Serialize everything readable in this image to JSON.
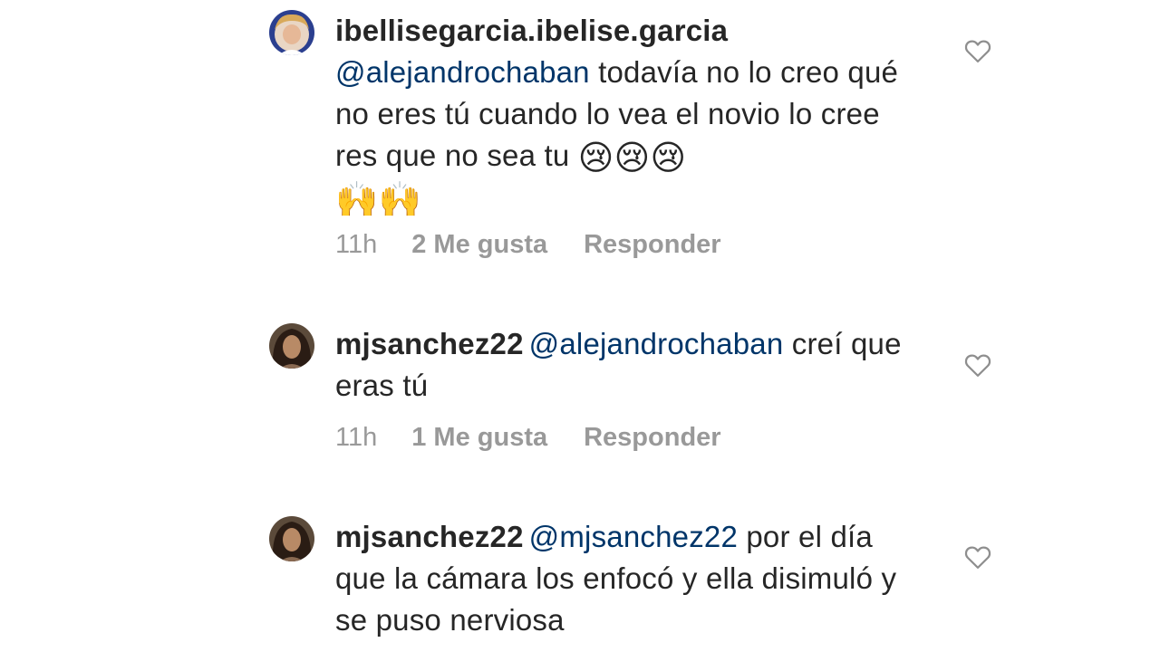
{
  "comments": [
    {
      "username": "ibellisegarcia.ibelise.garcia",
      "mention": "@alejandrochaban",
      "text": "todavía no lo creo qué no eres tú cuando lo vea el novio lo cree res que no sea tu",
      "emojis": [
        "😢",
        "😢",
        "😢",
        "🙌",
        "🙌"
      ],
      "time": "11h",
      "likes": "2 Me gusta",
      "reply": "Responder",
      "like_icon": "heart-outline-icon"
    },
    {
      "username": "mjsanchez22",
      "mention": "@alejandrochaban",
      "text": "creí que eras tú",
      "time": "11h",
      "likes": "1 Me gusta",
      "reply": "Responder",
      "like_icon": "heart-outline-icon"
    },
    {
      "username": "mjsanchez22",
      "mention": "@mjsanchez22",
      "text": "por el día que la cámara los enfocó y ella disimuló y se puso nerviosa",
      "like_icon": "heart-outline-icon"
    }
  ],
  "colors": {
    "text": "#262626",
    "mention": "#003569",
    "meta": "#999999",
    "heart": "#8e8e8e"
  }
}
